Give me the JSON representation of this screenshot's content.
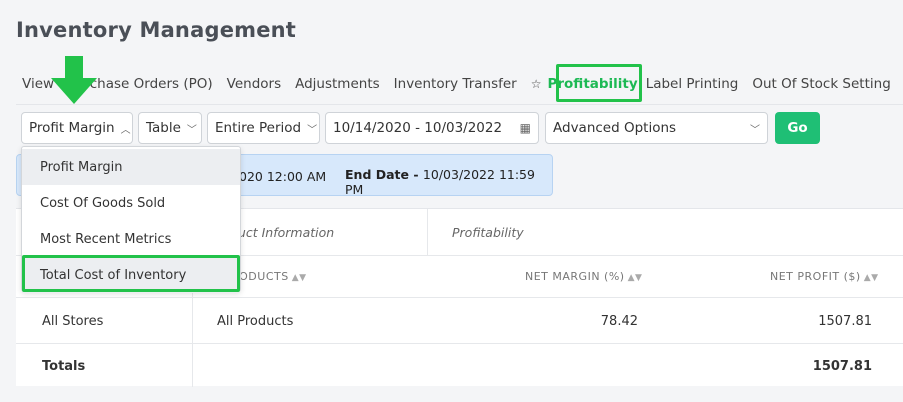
{
  "page": {
    "title": "Inventory Management"
  },
  "nav": {
    "tabs": [
      "View",
      "Purchase Orders (PO)",
      "Vendors",
      "Adjustments",
      "Inventory Transfer"
    ],
    "active": "Profitability",
    "after": [
      "Label Printing",
      "Out Of Stock Setting"
    ]
  },
  "controls": {
    "report": "Profit Margin",
    "view": "Table",
    "period": "Entire Period",
    "date_range": "10/14/2020 - 10/03/2022",
    "advanced": "Advanced Options",
    "go": "Go"
  },
  "dropdown": {
    "items": [
      "Profit Margin",
      "Cost Of Goods Sold",
      "Most Recent Metrics",
      "Total Cost of Inventory"
    ]
  },
  "dates": {
    "start_value": "020 12:00 AM",
    "end_label": "End Date",
    "end_value": "10/03/2022 11:59 PM"
  },
  "table": {
    "group_headers": [
      "duct Information",
      "Profitability"
    ],
    "columns": [
      "RODUCTS",
      "NET MARGIN (%)",
      "NET PROFIT ($)"
    ],
    "rows": [
      {
        "store": "All Stores",
        "product": "All Products",
        "net_margin": "78.42",
        "net_profit": "1507.81"
      }
    ],
    "totals": {
      "label": "Totals",
      "net_profit": "1507.81"
    }
  },
  "colors": {
    "accent": "#1db954",
    "go": "#1fbf75",
    "highlight": "#22c24a",
    "date_strip": "#d7e8fb"
  }
}
